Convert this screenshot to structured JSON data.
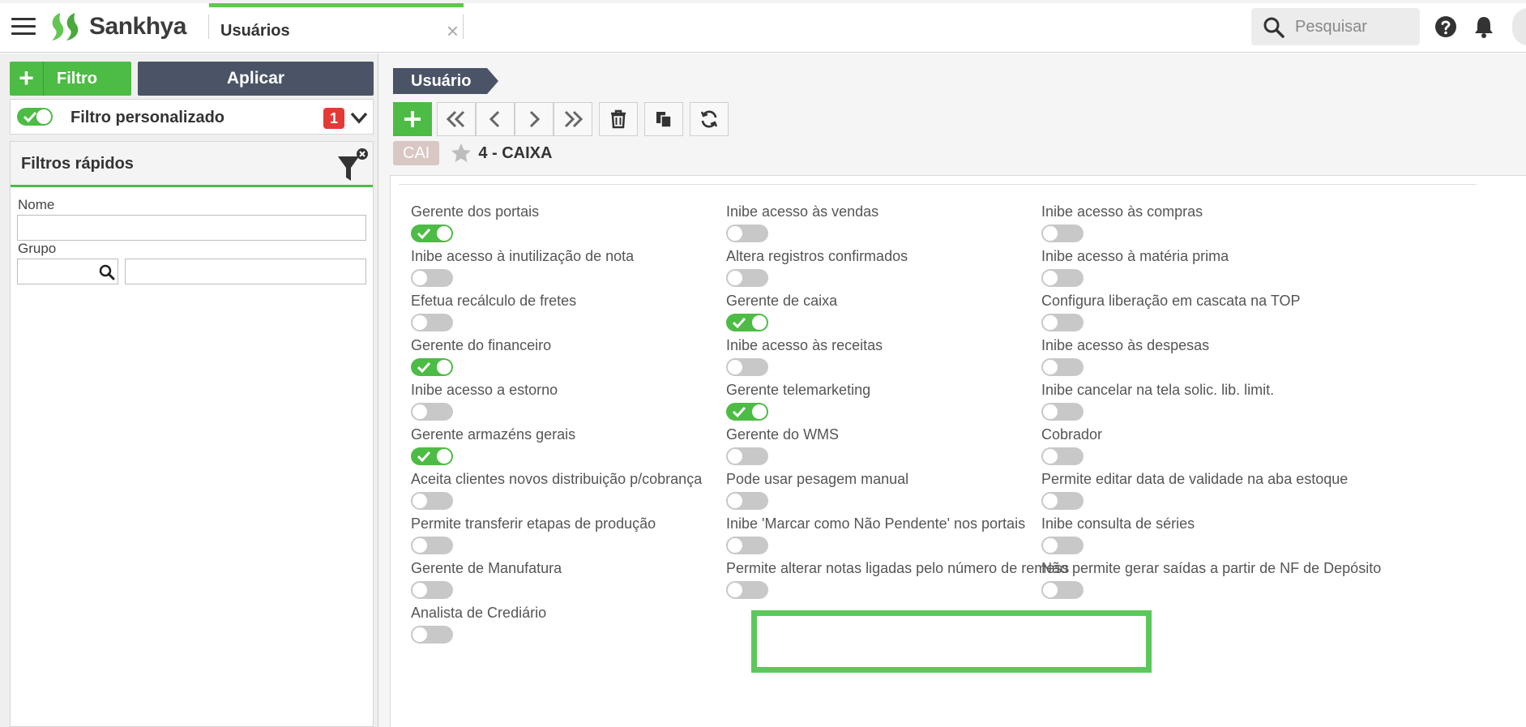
{
  "app": {
    "brand": "Sankhya",
    "tab_title": "Usuários",
    "tab_close": "×",
    "search_placeholder": "Pesquisar"
  },
  "left_panel": {
    "filter_button": "Filtro",
    "apply_button": "Aplicar",
    "custom_filter_label": "Filtro personalizado",
    "custom_filter_enabled": true,
    "custom_filter_count": "1",
    "quick_filters_title": "Filtros rápidos",
    "name_label": "Nome",
    "name_value": "",
    "group_label": "Grupo",
    "group_code_value": "",
    "group_name_value": ""
  },
  "form": {
    "title": "Usuário",
    "record_tag": "CAI",
    "record_title": "4 - CAIXA",
    "accent_color": "#4cbc45",
    "highlight_color": "#5cc85a",
    "highlighted_field": "Permite alterar notas ligadas pelo número de remess",
    "columns": [
      [
        {
          "label": "Gerente dos portais",
          "on": true
        },
        {
          "label": "Inibe acesso à inutilização de nota",
          "on": false
        },
        {
          "label": "Efetua recálculo de fretes",
          "on": false
        },
        {
          "label": "Gerente do financeiro",
          "on": true
        },
        {
          "label": "Inibe acesso a estorno",
          "on": false
        },
        {
          "label": "Gerente armazéns gerais",
          "on": true
        },
        {
          "label": "Aceita clientes novos distribuição p/cobrança",
          "on": false
        },
        {
          "label": "Permite transferir etapas de produção",
          "on": false
        },
        {
          "label": "Gerente de Manufatura",
          "on": false
        },
        {
          "label": "Analista de Crediário",
          "on": false
        }
      ],
      [
        {
          "label": "Inibe acesso às vendas",
          "on": false
        },
        {
          "label": "Altera registros confirmados",
          "on": false
        },
        {
          "label": "Gerente de caixa",
          "on": true
        },
        {
          "label": "Inibe acesso às receitas",
          "on": false
        },
        {
          "label": "Gerente telemarketing",
          "on": true
        },
        {
          "label": "Gerente do WMS",
          "on": false
        },
        {
          "label": "Pode usar pesagem manual",
          "on": false
        },
        {
          "label": "Inibe 'Marcar como Não Pendente' nos portais",
          "on": false
        },
        {
          "label": "Permite alterar notas ligadas pelo número de remess",
          "on": false
        }
      ],
      [
        {
          "label": "Inibe acesso às compras",
          "on": false
        },
        {
          "label": "Inibe acesso à matéria prima",
          "on": false
        },
        {
          "label": "Configura liberação em cascata na TOP",
          "on": false
        },
        {
          "label": "Inibe acesso às despesas",
          "on": false
        },
        {
          "label": "Inibe cancelar na tela solic. lib. limit.",
          "on": false
        },
        {
          "label": "Cobrador",
          "on": false
        },
        {
          "label": "Permite editar data de validade na aba estoque",
          "on": false
        },
        {
          "label": "Inibe consulta de séries",
          "on": false
        },
        {
          "label": "Não permite gerar saídas a partir de NF de Depósito",
          "on": false
        }
      ]
    ]
  }
}
